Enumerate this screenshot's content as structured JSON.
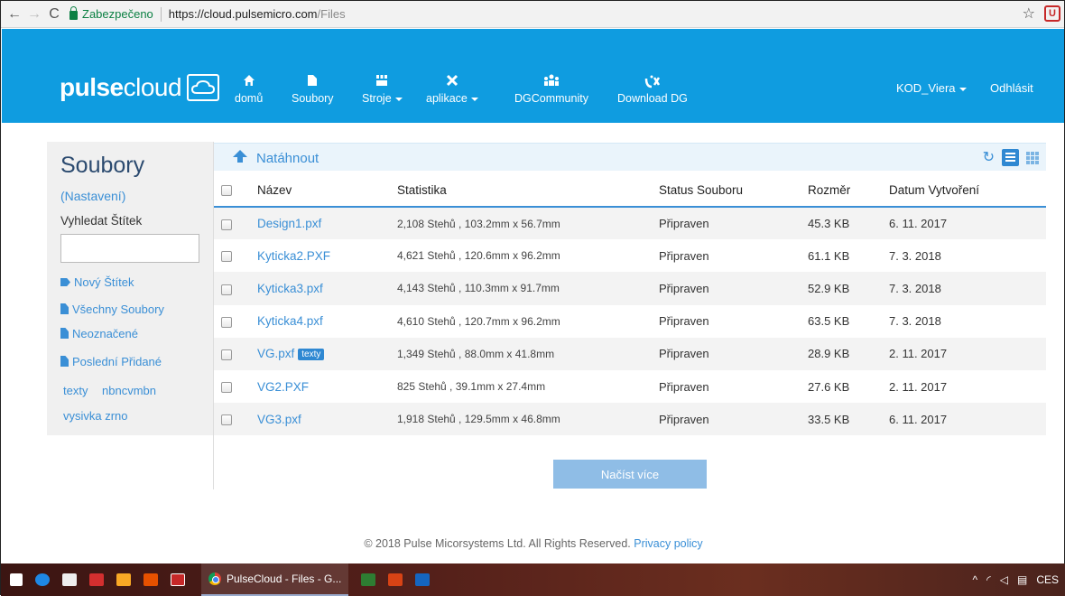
{
  "browser": {
    "secure_label": "Zabezpečeno",
    "url_host": "https://cloud.pulsemicro.com",
    "url_path": "/Files"
  },
  "header": {
    "logo_bold": "pulse",
    "logo_thin": "cloud",
    "nav": [
      {
        "label": "domů",
        "icon": "home-icon"
      },
      {
        "label": "Soubory",
        "icon": "file-icon"
      },
      {
        "label": "Stroje",
        "icon": "machines-icon"
      },
      {
        "label": "aplikace",
        "icon": "tools-icon"
      },
      {
        "label": "DGCommunity",
        "icon": "community-icon"
      },
      {
        "label": "Download DG",
        "icon": "download-dg-icon"
      }
    ],
    "user": "KOD_Viera",
    "logout": "Odhlásit"
  },
  "sidebar": {
    "title": "Soubory",
    "settings": "(Nastavení)",
    "search_label": "Vyhledat Štítek",
    "search_value": "",
    "links": [
      "Nový Štítek",
      "Všechny Soubory",
      "Neoznačené",
      "Poslední Přidané"
    ],
    "tags": [
      "texty",
      "nbncvmbn",
      "vysivka zrno"
    ]
  },
  "main": {
    "upload": "Natáhnout",
    "columns": [
      "Název",
      "Statistika",
      "Status Souboru",
      "Rozměr",
      "Datum Vytvoření"
    ],
    "rows": [
      {
        "name": "Design1.pxf",
        "tag": "",
        "stats": "2,108 Stehů , 103.2mm x 56.7mm",
        "status": "Připraven",
        "size": "45.3 KB",
        "date": "6. 11. 2017"
      },
      {
        "name": "Kyticka2.PXF",
        "tag": "",
        "stats": "4,621 Stehů , 120.6mm x 96.2mm",
        "status": "Připraven",
        "size": "61.1 KB",
        "date": "7. 3. 2018"
      },
      {
        "name": "Kyticka3.pxf",
        "tag": "",
        "stats": "4,143 Stehů , 110.3mm x 91.7mm",
        "status": "Připraven",
        "size": "52.9 KB",
        "date": "7. 3. 2018"
      },
      {
        "name": "Kyticka4.pxf",
        "tag": "",
        "stats": "4,610 Stehů , 120.7mm x 96.2mm",
        "status": "Připraven",
        "size": "63.5 KB",
        "date": "7. 3. 2018"
      },
      {
        "name": "VG.pxf",
        "tag": "texty",
        "stats": "1,349 Stehů , 88.0mm x 41.8mm",
        "status": "Připraven",
        "size": "28.9 KB",
        "date": "2. 11. 2017"
      },
      {
        "name": "VG2.PXF",
        "tag": "",
        "stats": "825 Stehů , 39.1mm x 27.4mm",
        "status": "Připraven",
        "size": "27.6 KB",
        "date": "2. 11. 2017"
      },
      {
        "name": "VG3.pxf",
        "tag": "",
        "stats": "1,918 Stehů , 129.5mm x 46.8mm",
        "status": "Připraven",
        "size": "33.5 KB",
        "date": "6. 11. 2017"
      }
    ],
    "load_more": "Načíst více"
  },
  "footer": {
    "copyright": "© 2018 Pulse Micorsystems Ltd. All Rights Reserved.",
    "privacy": "Privacy policy"
  },
  "taskbar": {
    "active_task": "PulseCloud - Files - G...",
    "lang": "CES"
  },
  "colors": {
    "header": "#0f9ce0",
    "link": "#3a8fd6",
    "button": "#8fbde6"
  }
}
